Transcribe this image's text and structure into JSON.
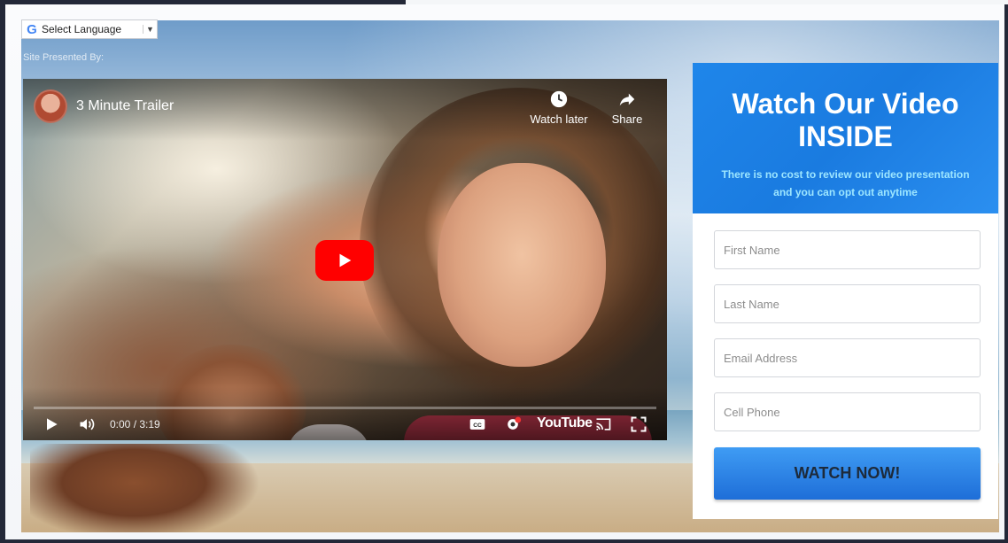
{
  "translate": {
    "label": "Select Language",
    "arrow": "▼",
    "logo": "G"
  },
  "presented_by": "Site Presented By:",
  "video": {
    "title": "3 Minute Trailer",
    "watch_later": "Watch later",
    "share": "Share",
    "time": "0:00 / 3:19",
    "progress": 0.0,
    "brand": "YouTube"
  },
  "panel": {
    "heading_line1": "Watch Our Video",
    "heading_line2": "INSIDE",
    "subtext_line1": "There is no cost to review our video presentation",
    "subtext_line2": "and you can opt out anytime",
    "fields": {
      "first_name": "First Name",
      "last_name": "Last Name",
      "email": "Email Address",
      "phone": "Cell Phone"
    },
    "button": "WATCH NOW!"
  },
  "colors": {
    "panel_blue": "#1f86ea",
    "subtext": "#9de6ff",
    "button_top": "#3f9cf4",
    "button_bottom": "#1e6ed8",
    "yt_red": "#ff0000"
  }
}
